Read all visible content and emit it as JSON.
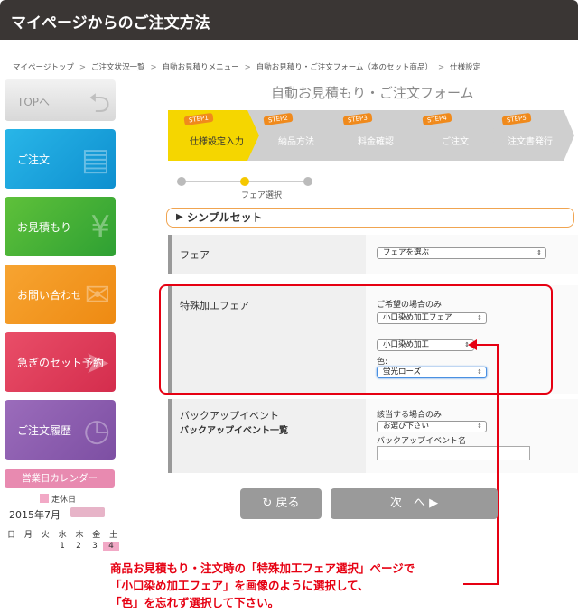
{
  "header": {
    "title": "マイページからのご注文方法"
  },
  "breadcrumb": [
    "マイページトップ",
    "ご注文状況一覧",
    "自動お見積りメニュー",
    "自動お見積り・ご注文フォーム（本のセット商品）",
    "仕様設定"
  ],
  "breadcrumb_sep": ">",
  "sidebar": {
    "items": [
      {
        "label": "TOPへ"
      },
      {
        "label": "ご注文"
      },
      {
        "label": "お見積もり"
      },
      {
        "label": "お問い合わせ"
      },
      {
        "label": "急ぎのセット予約"
      },
      {
        "label": "ご注文履歴"
      }
    ]
  },
  "calendar": {
    "title": "営業日カレンダー",
    "holiday_label": "定休日",
    "month": "2015年7月",
    "weekdays": "日 月 火 水 木 金 土",
    "dates": [
      "1",
      "2",
      "3",
      "4"
    ]
  },
  "form": {
    "title": "自動お見積もり・ご注文フォーム",
    "steps": [
      {
        "badge": "STEP1",
        "label": "仕様設定入力"
      },
      {
        "badge": "STEP2",
        "label": "納品方法"
      },
      {
        "badge": "STEP3",
        "label": "料金確認"
      },
      {
        "badge": "STEP4",
        "label": "ご注文"
      },
      {
        "badge": "STEP5",
        "label": "注文書発行"
      }
    ],
    "progress_label": "フェア選択",
    "section_title": "シンプルセット",
    "fair": {
      "label": "フェア",
      "select": "フェアを選ぶ"
    },
    "special": {
      "label": "特殊加工フェア",
      "hint": "ご希望の場合のみ",
      "select1": "小口染め加工フェア",
      "select2": "小口染め加工",
      "color_label": "色:",
      "select3": "蛍光ローズ"
    },
    "backup": {
      "label": "バックアップイベント",
      "link": "バックアップイベント一覧",
      "hint": "該当する場合のみ",
      "select": "お選び下さい",
      "name_label": "バックアップイベント名",
      "name_value": ""
    },
    "back_button": "戻る",
    "next_button": "次　へ"
  },
  "note": {
    "line1": "商品お見積もり・注文時の「特殊加工フェア選択」ページで",
    "line2": "「小口染め加工フェア」を画像のように選択して、",
    "line3": "「色」を忘れず選択して下さい。"
  },
  "colors": {
    "accent_red": "#e60012",
    "step_active": "#f5d600"
  }
}
